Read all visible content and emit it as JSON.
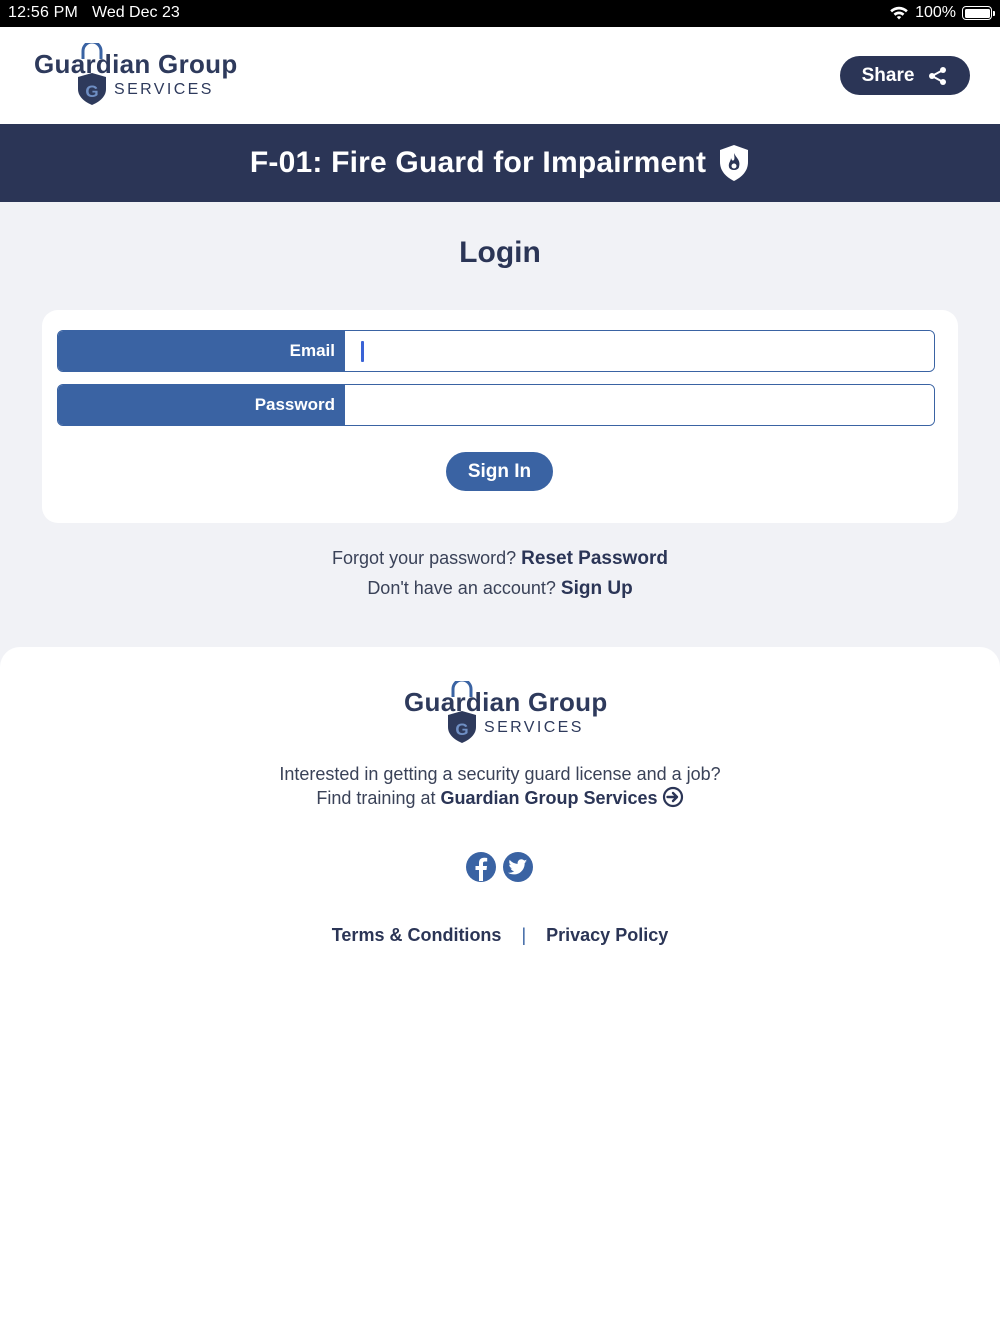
{
  "status_bar": {
    "time": "12:56 PM",
    "date": "Wed Dec 23",
    "battery": "100%"
  },
  "header": {
    "logo_brand": "Guardian Group",
    "logo_sub": "SERVICES",
    "share_label": "Share"
  },
  "banner": {
    "title": "F-01: Fire Guard for Impairment"
  },
  "login": {
    "heading": "Login",
    "email_label": "Email",
    "email_value": "",
    "password_label": "Password",
    "password_value": "",
    "signin_label": "Sign In",
    "forgot_text": "Forgot your password?",
    "reset_link": "Reset Password",
    "no_account_text": "Don't have an account?",
    "signup_link": "Sign Up"
  },
  "footer": {
    "logo_brand": "Guardian Group",
    "logo_sub": "SERVICES",
    "promo_line1": "Interested in getting a security guard license and a job?",
    "promo_line2_prefix": "Find training at",
    "promo_link": "Guardian Group Services",
    "terms": "Terms & Conditions",
    "separator": "|",
    "privacy": "Privacy Policy"
  },
  "icons": {
    "share": "share-icon",
    "fire_shield": "fire-shield-icon",
    "facebook": "facebook-icon",
    "twitter": "twitter-icon",
    "arrow": "arrow-circle-right-icon"
  },
  "colors": {
    "navy": "#2b3556",
    "accent_blue": "#3a63a3",
    "page_bg": "#f1f2f6"
  }
}
